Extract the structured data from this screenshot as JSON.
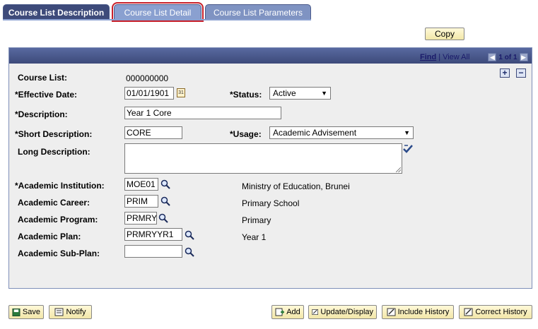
{
  "tabs": [
    {
      "label": "Course List Description",
      "state": "active-main"
    },
    {
      "label": "Course List Detail",
      "state": "selected"
    },
    {
      "label": "Course List Parameters",
      "state": "normal"
    }
  ],
  "copy_button": "Copy",
  "nav": {
    "find": "Find",
    "separator": "|",
    "view_all": "View All",
    "page_info": "1 of 1"
  },
  "form": {
    "course_list": {
      "label": "Course List:",
      "value": "000000000"
    },
    "effective_date": {
      "label": "*Effective Date:",
      "value": "01/01/1901"
    },
    "status": {
      "label": "*Status:",
      "value": "Active"
    },
    "description": {
      "label": "*Description:",
      "value": "Year 1 Core"
    },
    "short_description": {
      "label": "*Short Description:",
      "value": "CORE"
    },
    "usage": {
      "label": "*Usage:",
      "value": "Academic Advisement"
    },
    "long_description": {
      "label": "Long Description:",
      "value": ""
    },
    "academic_institution": {
      "label": "*Academic Institution:",
      "value": "MOE01",
      "desc": "Ministry of Education, Brunei"
    },
    "academic_career": {
      "label": "Academic Career:",
      "value": "PRIM",
      "desc": "Primary School"
    },
    "academic_program": {
      "label": "Academic Program:",
      "value": "PRMRY",
      "desc": "Primary"
    },
    "academic_plan": {
      "label": "Academic Plan:",
      "value": "PRMRYYR1",
      "desc": "Year 1"
    },
    "academic_subplan": {
      "label": "Academic Sub-Plan:",
      "value": ""
    }
  },
  "toolbar": {
    "save": "Save",
    "notify": "Notify",
    "add": "Add",
    "update_display": "Update/Display",
    "include_history": "Include History",
    "correct_history": "Correct History"
  },
  "colors": {
    "tab_dark": "#3d4a7a",
    "tab_light": "#8aa0d0",
    "panel_bg": "#eeeeee",
    "button_bg": "#f2e7a8",
    "highlight": "#c8202a"
  }
}
